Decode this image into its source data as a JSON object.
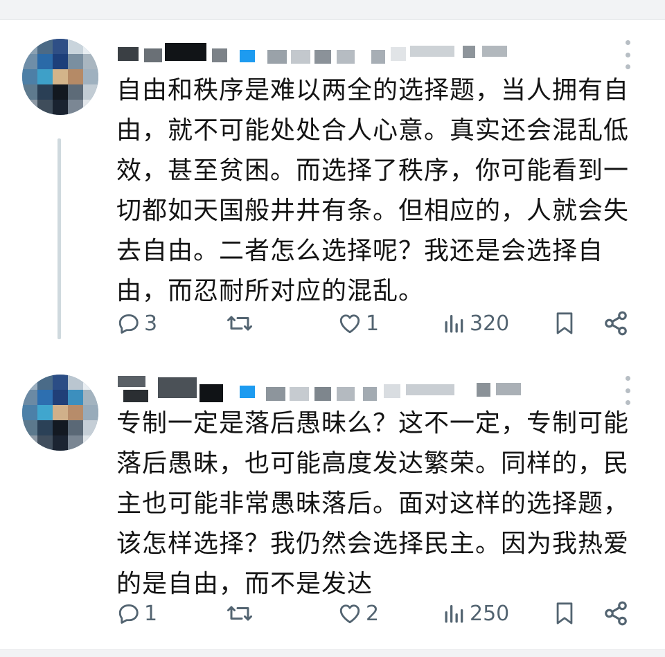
{
  "posts": [
    {
      "text": "自由和秩序是难以两全的选择题，当人拥有自由，就不可能处处合人心意。真实还会混乱低效，甚至贫困。而选择了秩序，你可能看到一切都如天国般井井有条。但相应的，人就会失去自由。二者怎么选择呢？我还是会选择自由，而忍耐所对应的混乱。",
      "replies": "3",
      "likes": "1",
      "views": "320"
    },
    {
      "text": "专制一定是落后愚昧么？这不一定，专制可能落后愚昧，也可能高度发达繁荣。同样的，民主也可能非常愚昧落后。面对这样的选择题，该怎样选择？我仍然会选择民主。因为我热爱的是自由，而不是发达",
      "replies": "1",
      "likes": "2",
      "views": "250"
    }
  ],
  "icons": {
    "reply": "reply-icon",
    "repost": "repost-icon",
    "like": "heart-icon",
    "views": "views-icon",
    "bookmark": "bookmark-icon",
    "share": "share-icon",
    "more": "more-icon"
  },
  "colors": {
    "icon": "#536471",
    "text": "#141414",
    "verified": "#1d9bf0"
  }
}
